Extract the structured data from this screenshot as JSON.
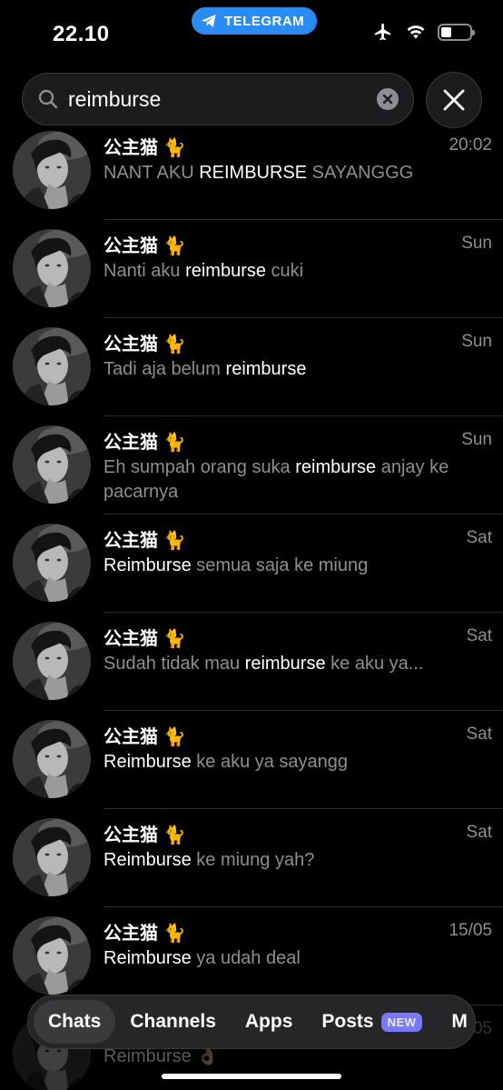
{
  "status_bar": {
    "time": "22.10",
    "app_label": "TELEGRAM",
    "battery_level": 0.35,
    "airplane_icon": "airplane-icon",
    "wifi_icon": "wifi-icon"
  },
  "search": {
    "value": "reimburse",
    "placeholder": "Search"
  },
  "results": [
    {
      "name": "公主猫 🐈",
      "date": "20:02",
      "pre": "NANT AKU ",
      "hl": "REIMBURSE",
      "post": " SAYANGGG",
      "wrap": false
    },
    {
      "name": "公主猫 🐈",
      "date": "Sun",
      "pre": "Nanti aku ",
      "hl": "reimburse",
      "post": " cuki",
      "wrap": false
    },
    {
      "name": "公主猫 🐈",
      "date": "Sun",
      "pre": "Tadi aja belum ",
      "hl": "reimburse",
      "post": "",
      "wrap": false
    },
    {
      "name": "公主猫 🐈",
      "date": "Sun",
      "pre": "Eh sumpah orang suka ",
      "hl": "reimburse",
      "post": " anjay ke pacarnya",
      "wrap": true
    },
    {
      "name": "公主猫 🐈",
      "date": "Sat",
      "pre": "",
      "hl": "Reimburse",
      "post": " semua saja ke miung",
      "wrap": false
    },
    {
      "name": "公主猫 🐈",
      "date": "Sat",
      "pre": "Sudah tidak mau ",
      "hl": "reimburse",
      "post": " ke aku ya...",
      "wrap": false
    },
    {
      "name": "公主猫 🐈",
      "date": "Sat",
      "pre": "",
      "hl": "Reimburse",
      "post": " ke aku ya sayangg",
      "wrap": false
    },
    {
      "name": "公主猫 🐈",
      "date": "Sat",
      "pre": "",
      "hl": "Reimburse",
      "post": " ke miung yah?",
      "wrap": false
    },
    {
      "name": "公主猫 🐈",
      "date": "15/05",
      "pre": "",
      "hl": "Reimburse",
      "post": " ya udah deal",
      "wrap": false
    },
    {
      "name": "公主猫 🐈",
      "date": "15/05",
      "pre": "",
      "hl": "Reimburse",
      "post": " 👌🏼",
      "wrap": false
    }
  ],
  "tabs": [
    {
      "label": "Chats",
      "active": true
    },
    {
      "label": "Channels",
      "active": false
    },
    {
      "label": "Apps",
      "active": false
    },
    {
      "label": "Posts",
      "active": false,
      "badge": "NEW"
    },
    {
      "label": "M",
      "active": false
    }
  ],
  "colors": {
    "accent": "#2a8bf2",
    "badge": "#7a7af0",
    "secondary_text": "#8e8e93"
  }
}
